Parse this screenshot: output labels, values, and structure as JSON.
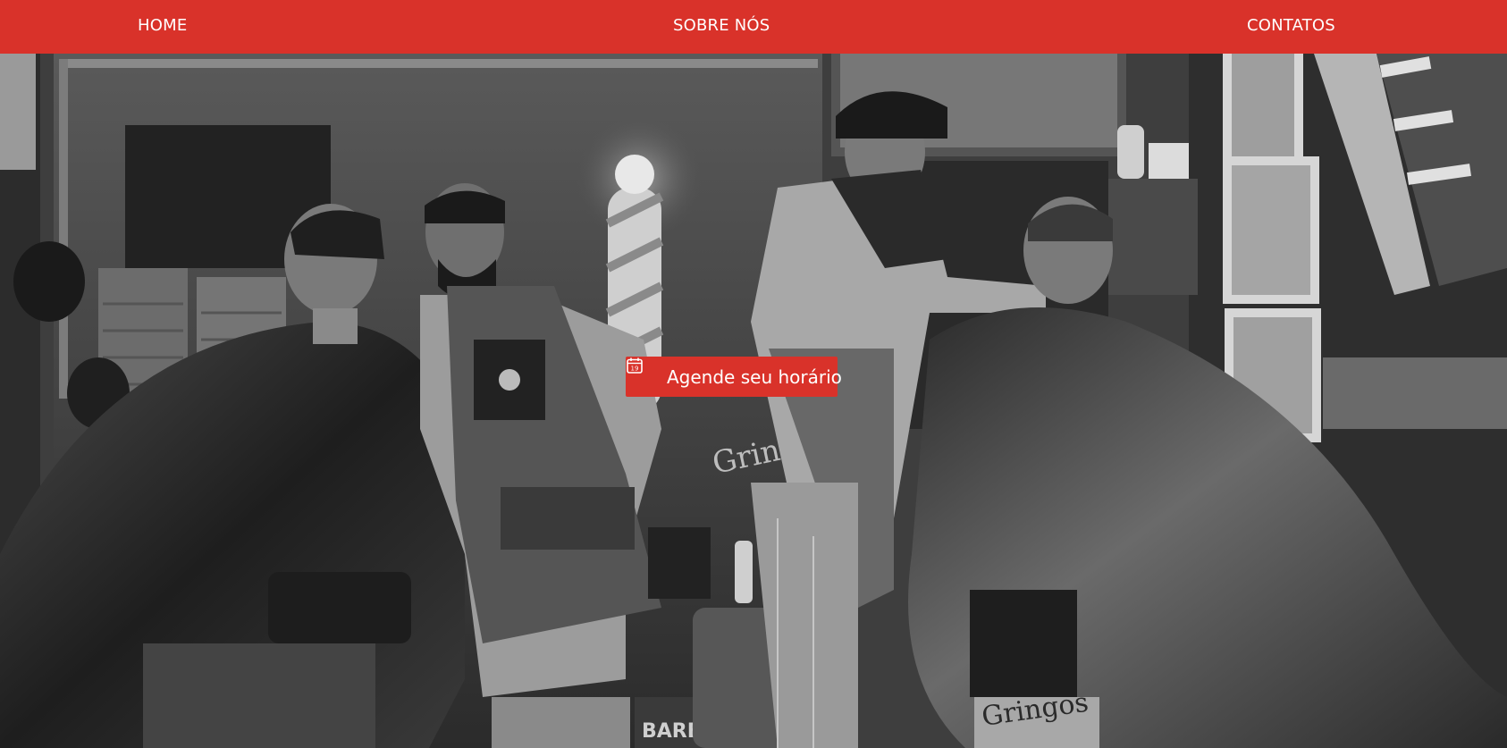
{
  "nav": {
    "items": [
      {
        "label": "HOME"
      },
      {
        "label": "SOBRE NÓS"
      },
      {
        "label": "CONTATOS"
      }
    ]
  },
  "hero": {
    "cta_label": "Agende seu horário",
    "cta_icon": "calendar-icon",
    "image_description_icon": "barbershop-photo"
  },
  "colors": {
    "accent": "#d9322a",
    "text_on_accent": "#ffffff"
  }
}
